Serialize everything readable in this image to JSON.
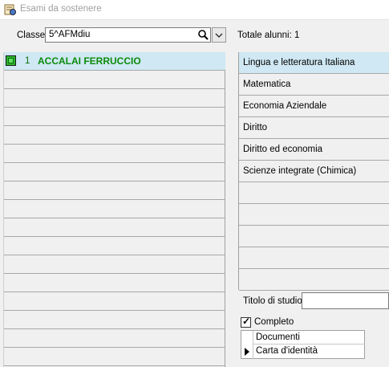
{
  "window": {
    "title": "Esami da sostenere"
  },
  "classe": {
    "label": "Classe",
    "value": "5^AFMdiu"
  },
  "totale": "Totale alunni: 1",
  "students": [
    {
      "number": "1",
      "name": "ACCALAI FERRUCCIO",
      "selected": true
    }
  ],
  "subjects": [
    {
      "label": "Lingua e letteratura Italiana"
    },
    {
      "label": "Matematica"
    },
    {
      "label": "Economia Aziendale"
    },
    {
      "label": "Diritto"
    },
    {
      "label": "Diritto ed economia"
    },
    {
      "label": "Scienze integrate (Chimica)"
    }
  ],
  "titolo_di_studio": {
    "label": "Titolo di studio",
    "value": ""
  },
  "completo": {
    "label": "Completo",
    "checked": true
  },
  "documenti": {
    "header": "Documenti",
    "rows": [
      "Carta d'identità"
    ]
  },
  "colors": {
    "student_green": "#0b8a0b",
    "selection_blue": "#cfe8f3"
  }
}
